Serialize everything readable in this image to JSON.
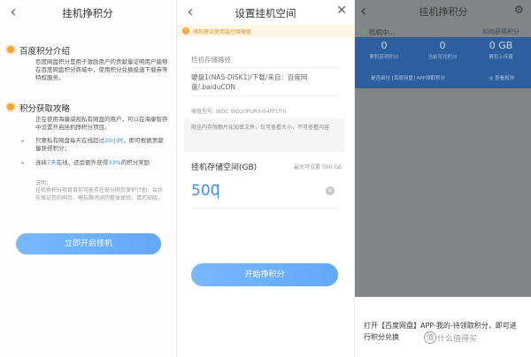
{
  "panel1": {
    "title": "挂机挣积分",
    "back_icon": "chevron-left-icon",
    "intro_heading": "百度积分介绍",
    "intro_text": "百度网盘积分是用于激励用户的贡献量证明用户能够在百度网盘积分商城中，使用积分兑换极速下载券等特权服务。",
    "strategy_heading": "积分获取攻略",
    "strategy_text": "正在使用海康威视私有网盘的用户，可以在海康智存中设置开启挂机挣积分项目。",
    "bullet1_pre": "只要私有网盘每天在线超过",
    "bullet1_hl": "20小时",
    "bullet1_post": "，即可根据贡献量获得积分；",
    "bullet2_pre": "连续",
    "bullet2_hl1": "7天",
    "bullet2_mid": "在线，还会额外获得",
    "bullet2_hl2": "33%",
    "bullet2_post": "的积分奖励",
    "note_label": "说明：",
    "note_text": "挂机挣积分项目目前可能存在部分网页保护计划，会优先保证您的网页，略抗腾鸿对的整体体验，请您知晓。",
    "start_button": "立即开启挂机"
  },
  "panel2": {
    "title": "设置挂机空间",
    "back_icon": "chevron-left-icon",
    "close_icon": "close-icon",
    "warning": "强烈建议使用监控级硬盘",
    "path_label": "挂机存储路径",
    "path_value": "硬盘1(NAS-DISK1)/下载/来自：百度网盘/.baiduCDN",
    "disk_model": "硬盘型号: WDC WD20PURX-64PFUY0",
    "tip": "限挂内存限额片化加密文件，仅可查看大小，不可查看内容",
    "space_label": "挂机存储空间(GB)",
    "max_available": "最大可设置 500 GB",
    "space_value": "500",
    "submit_button": "开始挣积分"
  },
  "panel3": {
    "title": "挂机挣积分",
    "back_icon": "chevron-left-icon",
    "gear_icon": "gear-icon",
    "status": "挂机中...",
    "how_to": "如何获得积分",
    "stats": [
      {
        "value": "0",
        "label": "累积获得积分"
      },
      {
        "value": "0",
        "label": "当前可兑积分"
      },
      {
        "value": "0 GB",
        "label": "累积上传量"
      }
    ],
    "action_text": "是否前往 [百度网盘] APP领取积分",
    "see_text": "◎ 查看规则",
    "sheet_text": "打开【百度网盘】APP-我的-待领取积分，即可进行积分兑换"
  },
  "watermark": {
    "logo": "值",
    "text": "什么值得买"
  },
  "colors": {
    "accent_blue": "#63a8f8",
    "warning_orange": "#f4a63a",
    "dim_overlay": "#838485",
    "card_blue": "#2d5fa0"
  }
}
